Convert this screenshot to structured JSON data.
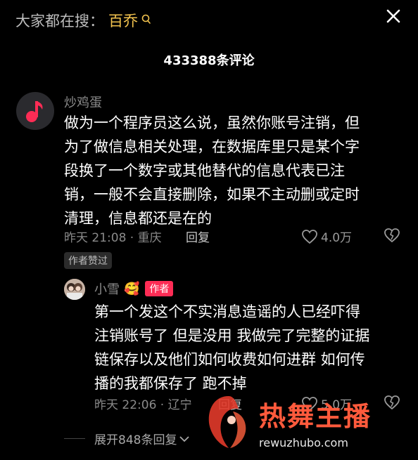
{
  "search": {
    "label": "大家都在搜：",
    "term": "百乔"
  },
  "comments_count": "433388条评论",
  "comment1": {
    "author": "炒鸡蛋",
    "text_lines": [
      "做为一个程序员这么说，虽然你账号注销，但",
      "为了做信息相关处理，在数据库里只是某个字",
      "段换了一个数字或其他替代的信息代表已注",
      "销，一般不会直接删除，如果不主动删或定时",
      "清理，信息都还是在的"
    ],
    "time_location": "昨天 21:08 · 重庆",
    "reply_label": "回复",
    "likes": "4.0万",
    "author_liked_badge": "作者赞过"
  },
  "reply1": {
    "author": "小雪",
    "emoji": "🥰",
    "author_badge": "作者",
    "text_lines": [
      "第一个发这个不实消息造谣的人已经吓得",
      "注销账号了 但是没用 我做完了完整的证据",
      "链保存以及他们如何收费如何进群 如何传",
      "播的我都保存了 跑不掉"
    ],
    "time_location": "昨天 22:06 · 辽宁",
    "reply_label": "回复",
    "likes": "5.0万"
  },
  "expand": {
    "label": "展开848条回复"
  },
  "watermark": {
    "brand": "热舞主播",
    "url": "rewuzhubo.com"
  },
  "colors": {
    "accent_yellow": "#f4c44f",
    "author_red": "#fe2c55",
    "background": "#000000"
  }
}
